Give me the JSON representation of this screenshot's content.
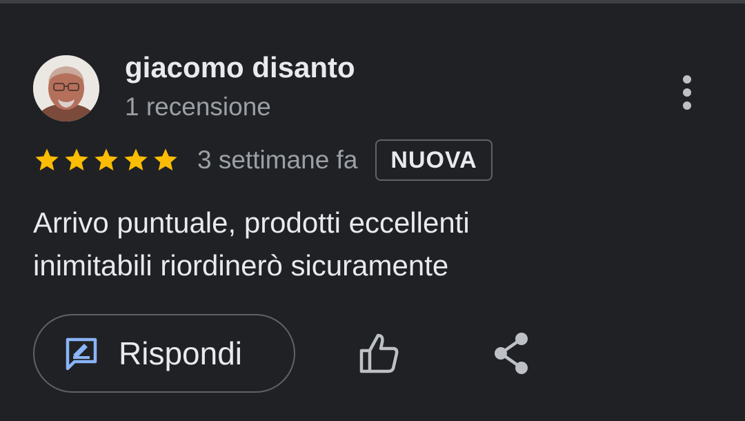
{
  "review": {
    "author_name": "giacomo disanto",
    "review_count": "1 recensione",
    "rating": 5,
    "max_rating": 5,
    "timestamp": "3 settimane fa",
    "badge": "NUOVA",
    "text_lines": [
      "Arrivo puntuale, prodotti eccellenti",
      "inimitabili riordinerò sicuramente"
    ]
  },
  "actions": {
    "reply_label": "Rispondi",
    "reply_icon": "reply-edit-icon",
    "like_icon": "thumbs-up-icon",
    "share_icon": "share-icon",
    "more_icon": "more-vertical-icon"
  },
  "colors": {
    "background": "#202124",
    "star": "#fbbc04",
    "reply_icon": "#8ab4f8",
    "text_primary": "#e8eaed",
    "text_secondary": "#9aa0a6"
  }
}
